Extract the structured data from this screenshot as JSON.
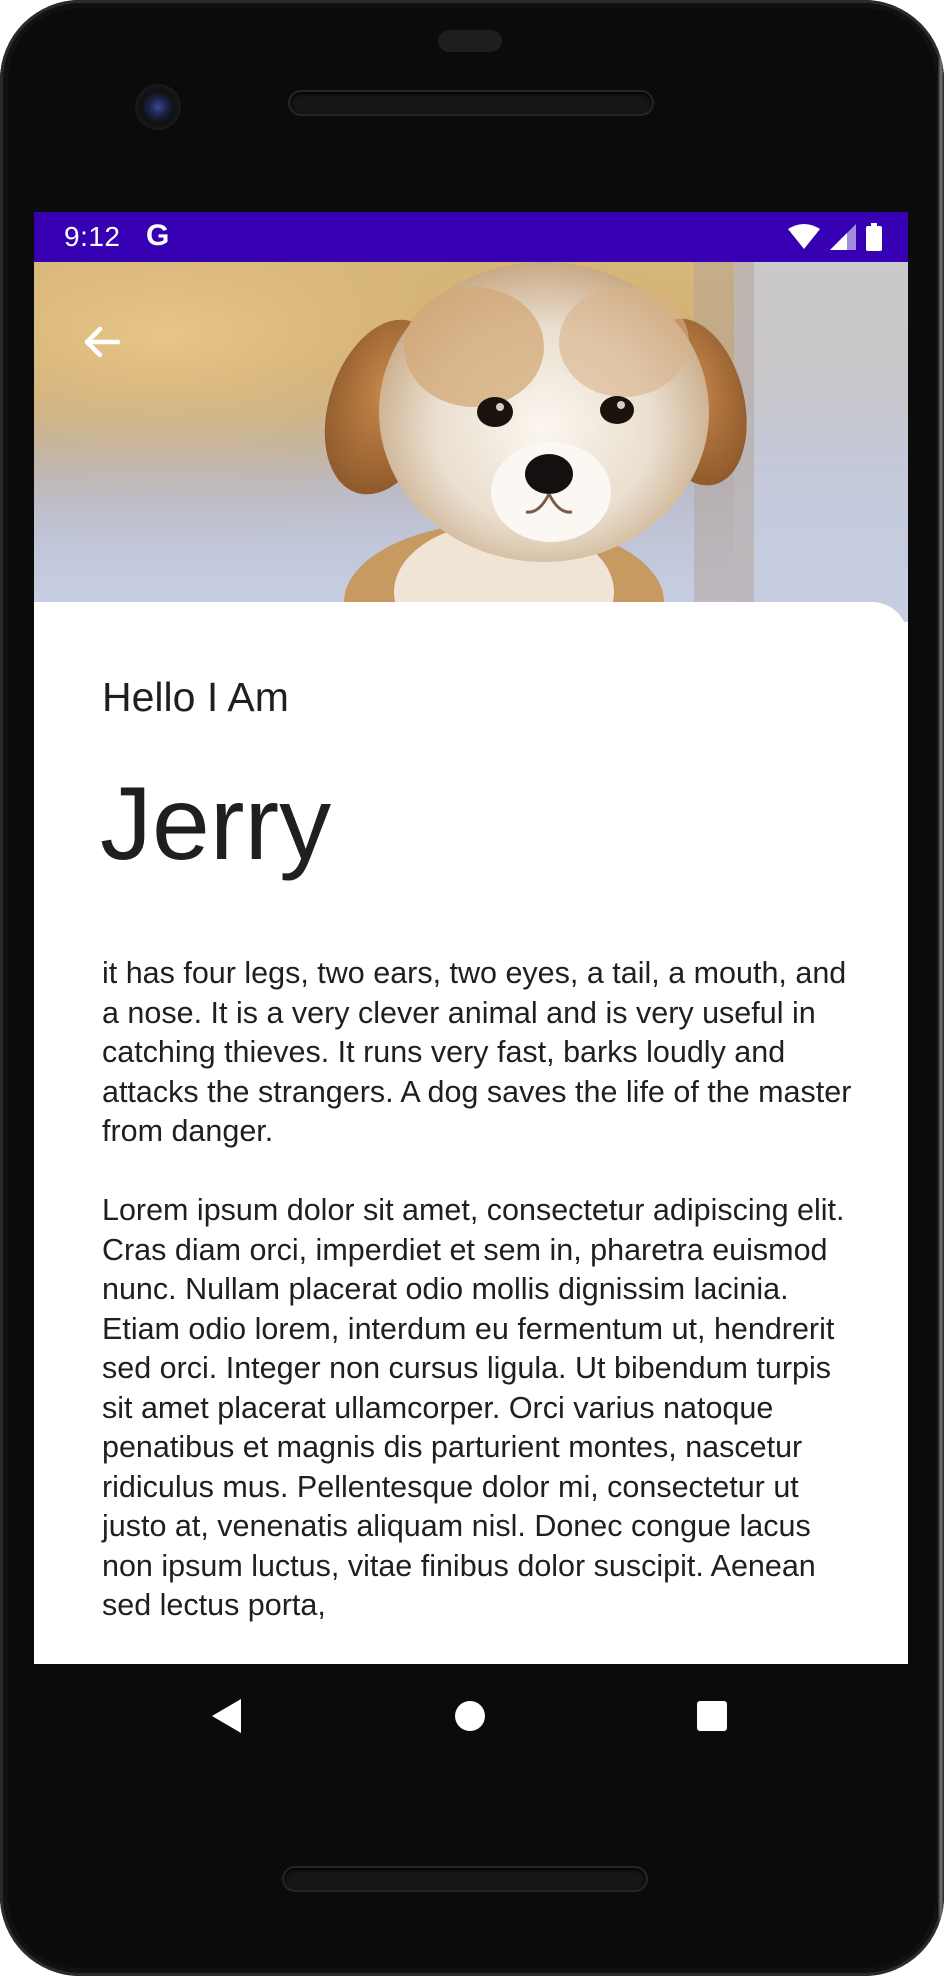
{
  "status_bar": {
    "time": "9:12",
    "google_glyph": "G",
    "icons": [
      "wifi-icon",
      "cell-signal-icon",
      "battery-icon"
    ],
    "background_color": "#3700b3"
  },
  "hero": {
    "image": "puppy-photo",
    "back_icon": "arrow-back-icon"
  },
  "content": {
    "greeting": "Hello I Am",
    "name": "Jerry",
    "description": "it has four legs, two ears, two eyes, a tail, a mouth, and a nose. It is a very clever animal and is very useful in catching thieves. It runs very fast, barks loudly and attacks the strangers. A dog saves the life of the master from danger.\n\nLorem ipsum dolor sit amet, consectetur adipiscing elit.  Cras diam orci, imperdiet et sem in, pharetra euismod nunc. Nullam placerat odio mollis dignissim lacinia. Etiam odio lorem, interdum eu fermentum ut, hendrerit sed orci. Integer non cursus ligula. Ut bibendum turpis sit amet placerat ullamcorper. Orci varius natoque penatibus et magnis dis parturient montes, nascetur ridiculus mus. Pellentesque dolor mi, consectetur ut justo at, venenatis aliquam nisl. Donec congue lacus non ipsum luctus, vitae finibus dolor suscipit. Aenean sed lectus porta,"
  },
  "navigation": {
    "back_icon": "nav-back-triangle-icon",
    "home_icon": "nav-home-circle-icon",
    "recents_icon": "nav-recents-square-icon"
  }
}
